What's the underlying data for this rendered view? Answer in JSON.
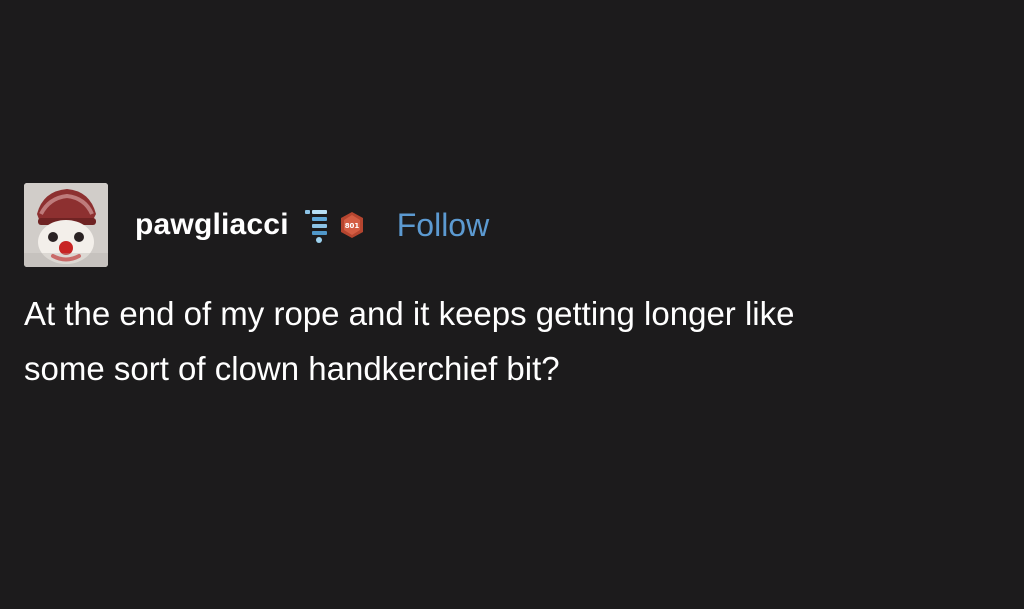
{
  "post": {
    "username": "pawgliacci",
    "follow_label": "Follow",
    "hex_badge_text": "801",
    "text_line_1": "At the end of my rope and it keeps getting longer like",
    "text_line_2": "some sort of clown handkerchief bit?"
  },
  "colors": {
    "background": "#1c1b1c",
    "text": "#ffffff",
    "follow": "#5c9ad1",
    "badge_blue": "#8cc3e6",
    "badge_red": "#b5452f"
  },
  "icons": {
    "avatar": "clown-avatar",
    "stack_badge": "stacked-blue-badge-icon",
    "hex_badge": "hexagon-badge-icon"
  }
}
